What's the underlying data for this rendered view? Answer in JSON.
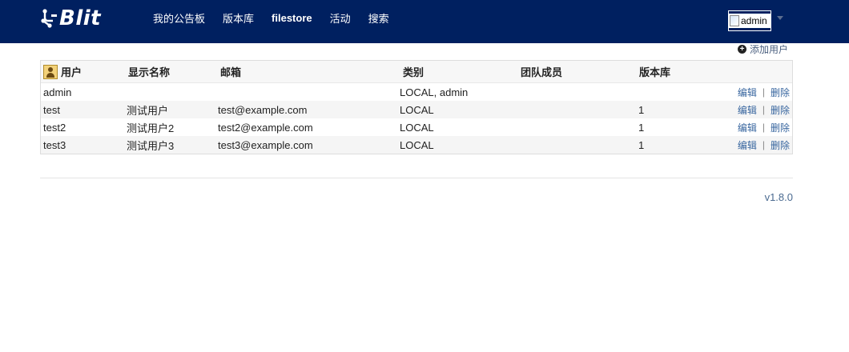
{
  "brand": {
    "logo_text": "Blit",
    "logo_icon": "gitblit-logo-icon"
  },
  "nav": {
    "items": [
      {
        "label": "我的公告板",
        "bold": false
      },
      {
        "label": "版本库",
        "bold": false
      },
      {
        "label": "filestore",
        "bold": true
      },
      {
        "label": "活动",
        "bold": false
      },
      {
        "label": "搜索",
        "bold": false
      }
    ]
  },
  "user_menu": {
    "avatar_alt": "admin",
    "icon": "chevron-down-icon"
  },
  "toolbar": {
    "add_user_label": "添加用户",
    "add_icon": "plus-circle-icon"
  },
  "table": {
    "columns": [
      "用户",
      "显示名称",
      "邮箱",
      "类别",
      "团队成员",
      "版本库"
    ],
    "rows": [
      {
        "user": "admin",
        "display_name": "",
        "email": "",
        "type": "LOCAL, admin",
        "teams": "",
        "repos": "",
        "edit": "编辑",
        "delete": "删除"
      },
      {
        "user": "test",
        "display_name": "测试用户",
        "email": "test@example.com",
        "type": "LOCAL",
        "teams": "",
        "repos": "1",
        "edit": "编辑",
        "delete": "删除"
      },
      {
        "user": "test2",
        "display_name": "测试用户2",
        "email": "test2@example.com",
        "type": "LOCAL",
        "teams": "",
        "repos": "1",
        "edit": "编辑",
        "delete": "删除"
      },
      {
        "user": "test3",
        "display_name": "测试用户3",
        "email": "test3@example.com",
        "type": "LOCAL",
        "teams": "",
        "repos": "1",
        "edit": "编辑",
        "delete": "删除"
      }
    ],
    "separator": "|"
  },
  "footer": {
    "version": "v1.8.0"
  },
  "colors": {
    "navbar": "#002060",
    "link": "#38669f",
    "version": "#4a6a90"
  }
}
